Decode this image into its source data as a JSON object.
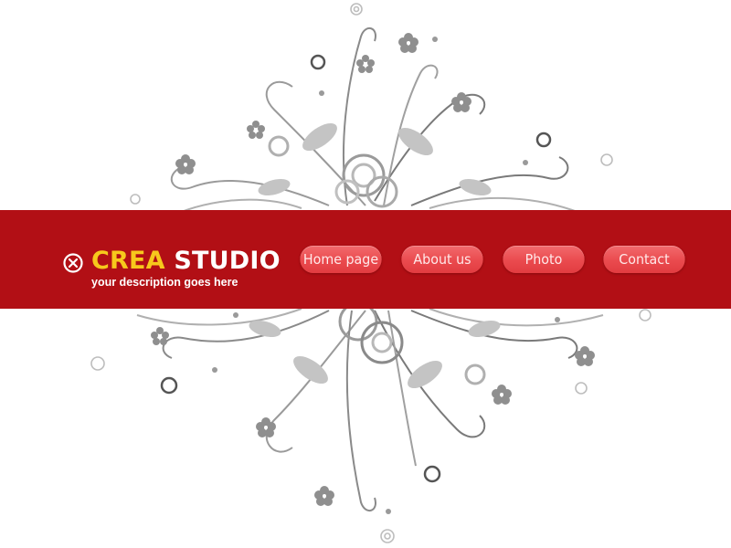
{
  "brand": {
    "name_part1": "CREA",
    "name_part2": "STUDIO",
    "tagline": "your description goes here",
    "logo_icon": "circled-x-icon"
  },
  "nav": {
    "items": [
      {
        "label": "Home page"
      },
      {
        "label": "About us"
      },
      {
        "label": "Photo"
      },
      {
        "label": "Contact"
      }
    ]
  },
  "colors": {
    "banner": "#b20f15",
    "brand_accent": "#f7c81c",
    "button": "#ea4a4e",
    "ornament": "#8a8a8a"
  }
}
